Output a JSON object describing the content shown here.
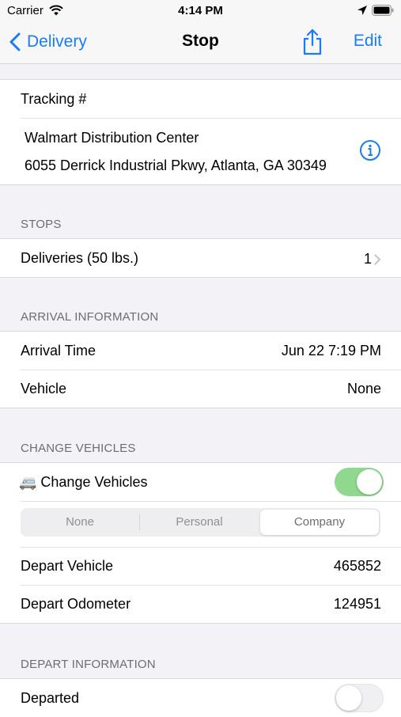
{
  "status_bar": {
    "carrier": "Carrier",
    "time": "4:14 PM"
  },
  "nav": {
    "back_label": "Delivery",
    "title": "Stop",
    "edit_label": "Edit"
  },
  "destination": {
    "tracking_label": "Tracking #",
    "name": "Walmart Distribution Center",
    "address": "6055 Derrick Industrial Pkwy, Atlanta, GA 30349"
  },
  "stops": {
    "header": "STOPS",
    "deliveries_label": "Deliveries (50 lbs.)",
    "deliveries_count": "1"
  },
  "arrival": {
    "header": "ARRIVAL INFORMATION",
    "arrival_time_label": "Arrival Time",
    "arrival_time_value": "Jun 22 7:19 PM",
    "vehicle_label": "Vehicle",
    "vehicle_value": "None"
  },
  "change_vehicles": {
    "header": "CHANGE VEHICLES",
    "toggle_label": "🚐 Change Vehicles",
    "toggle_on": true,
    "segments": [
      "None",
      "Personal",
      "Company"
    ],
    "selected_segment": "Company",
    "depart_vehicle_label": "Depart Vehicle",
    "depart_vehicle_value": "465852",
    "depart_odometer_label": "Depart Odometer",
    "depart_odometer_value": "124951"
  },
  "depart": {
    "header": "DEPART INFORMATION",
    "departed_label": "Departed",
    "departed_on": false
  },
  "colors": {
    "accent": "#1a7cf5",
    "toggle_on": "#8fd88e",
    "background": "#f2f2f7"
  }
}
